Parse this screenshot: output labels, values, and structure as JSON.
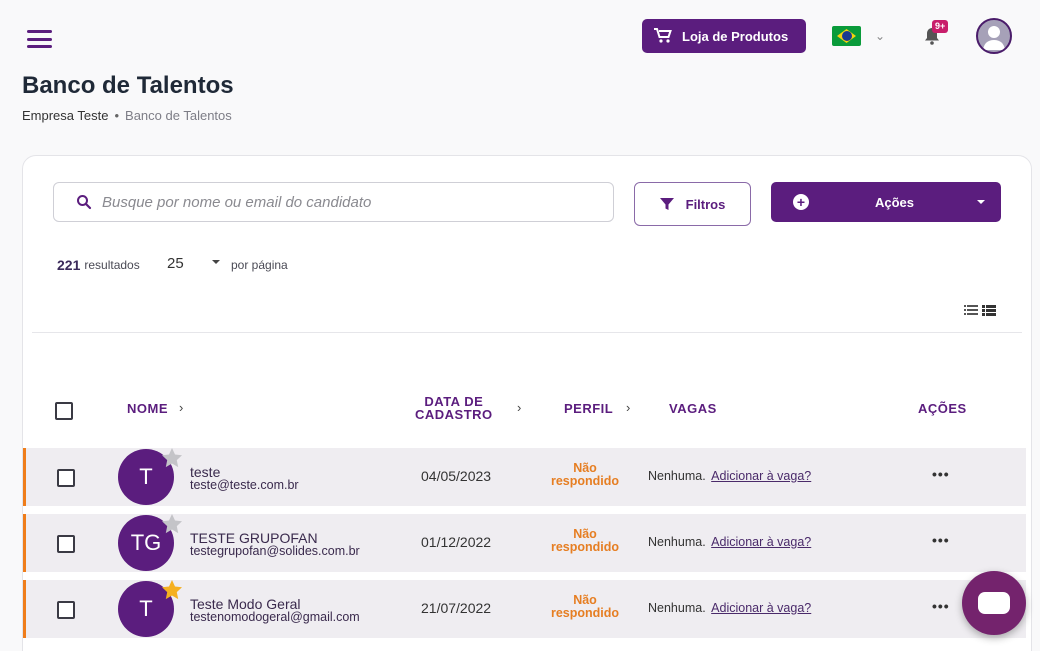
{
  "header": {
    "shop_label": "Loja de Produtos",
    "notification_badge": "9+"
  },
  "page": {
    "title": "Banco de Talentos",
    "breadcrumb": [
      "Empresa Teste",
      "•",
      "Banco de Talentos"
    ]
  },
  "toolbar": {
    "search_placeholder": "Busque por nome ou email do candidato",
    "filters_label": "Filtros",
    "actions_label": "Ações",
    "actions_icon": "+"
  },
  "results": {
    "count": "221",
    "count_label": "resultados",
    "per_page": "25",
    "per_page_label": "por página"
  },
  "table": {
    "headers": {
      "name": "NOME",
      "date_line1": "DATA DE",
      "date_line2": "CADASTRO",
      "profile": "PERFIL",
      "jobs": "VAGAS",
      "actions": "AÇÕES"
    },
    "rows": [
      {
        "initials": "T",
        "starred": false,
        "name": "teste",
        "email": "teste@teste.com.br",
        "date": "04/05/2023",
        "status_line1": "Não",
        "status_line2": "respondido",
        "jobs": "Nenhuma.",
        "jobs_link": "Adicionar à vaga?",
        "actions": "•••"
      },
      {
        "initials": "TG",
        "starred": false,
        "name": "TESTE GRUPOFAN",
        "email": "testegrupofan@solides.com.br",
        "date": "01/12/2022",
        "status_line1": "Não",
        "status_line2": "respondido",
        "jobs": "Nenhuma.",
        "jobs_link": "Adicionar à vaga?",
        "actions": "•••"
      },
      {
        "initials": "T",
        "starred": true,
        "name": "Teste Modo Geral",
        "email": "testenomodogeral@gmail.com",
        "date": "21/07/2022",
        "status_line1": "Não",
        "status_line2": "respondido",
        "jobs": "Nenhuma.",
        "jobs_link": "Adicionar à vaga?",
        "actions": "•••"
      }
    ]
  },
  "colors": {
    "brand": "#5b1d7e",
    "status": "#e67e22",
    "row_accent": "#ef7d1a",
    "star_on": "#f5b021",
    "star_off": "#c4c4c8"
  },
  "icons": [
    "menu-icon",
    "cart-icon",
    "brazil-flag-icon",
    "chevron-down-icon",
    "bell-icon",
    "user-avatar-icon",
    "search-icon",
    "filter-icon",
    "plus-circle-icon",
    "caret-down-icon",
    "list-view-icon",
    "detail-view-icon",
    "chevron-right-icon",
    "star-icon",
    "more-icon",
    "chat-icon"
  ]
}
